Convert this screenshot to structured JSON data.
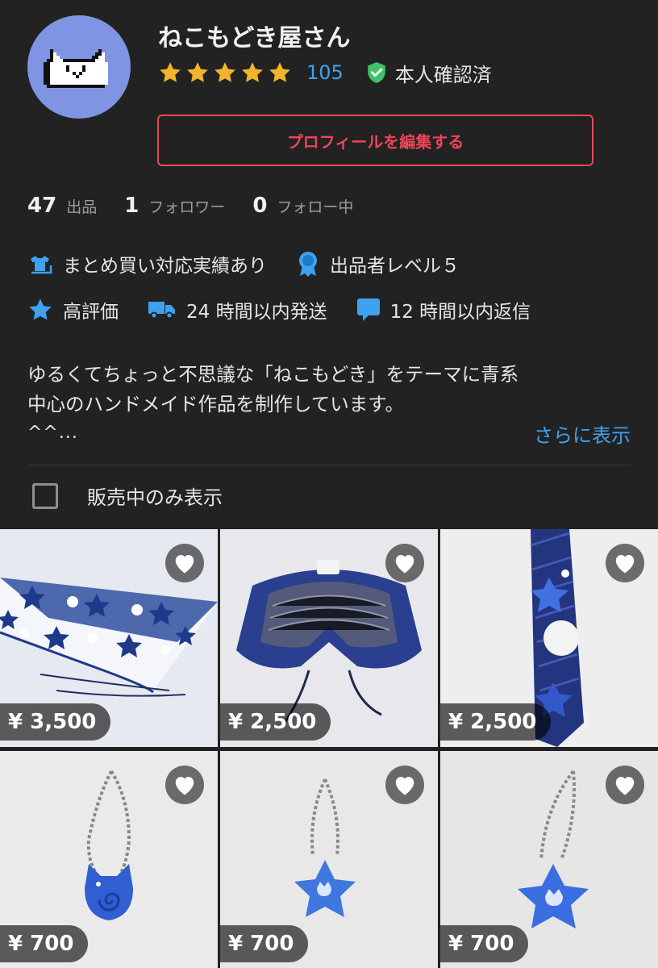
{
  "profile": {
    "shop_name": "ねこもどき屋さん",
    "rating_stars": 5,
    "rating_count": "105",
    "verified_label": "本人確認済",
    "edit_button_label": "プロフィールを編集する"
  },
  "stats": [
    {
      "count": "47",
      "label": "出品"
    },
    {
      "count": "1",
      "label": "フォロワー"
    },
    {
      "count": "0",
      "label": "フォロー中"
    }
  ],
  "features": [
    {
      "icon": "bundle-shirt-icon",
      "label": "まとめ買い対応実績あり"
    },
    {
      "icon": "medal-icon",
      "label": "出品者レベル５"
    },
    {
      "icon": "star-icon",
      "label": "高評価"
    },
    {
      "icon": "truck-icon",
      "label": "24 時間以内発送"
    },
    {
      "icon": "chat-bubble-icon",
      "label": "12 時間以内返信"
    }
  ],
  "bio": {
    "text": "ゆるくてちょっと不思議な「ねこもどき」をテーマに青系\n中心のハンドメイド作品を制作しています。",
    "more_chars": "^^...",
    "show_more_label": "さらに表示"
  },
  "filter": {
    "label": "販売中のみ表示",
    "checked": false
  },
  "items": [
    {
      "price": "¥ 3,500",
      "photo": "crochet-star-triangle-scarf"
    },
    {
      "price": "¥ 2,500",
      "photo": "knit-collar"
    },
    {
      "price": "¥ 2,500",
      "photo": "embroidered-tie"
    },
    {
      "price": "¥ 700",
      "photo": "cat-swirl-keychain"
    },
    {
      "price": "¥ 700",
      "photo": "star-cat-keychain"
    },
    {
      "price": "¥ 700",
      "photo": "star-cat-keychain"
    }
  ],
  "colors": {
    "background": "#222222",
    "accent_blue": "#3ea2f0",
    "star_gold": "#f2b42c",
    "edit_red": "#ea4659",
    "verified_green": "#3fc36a",
    "avatar_bg": "#7f95e3"
  }
}
